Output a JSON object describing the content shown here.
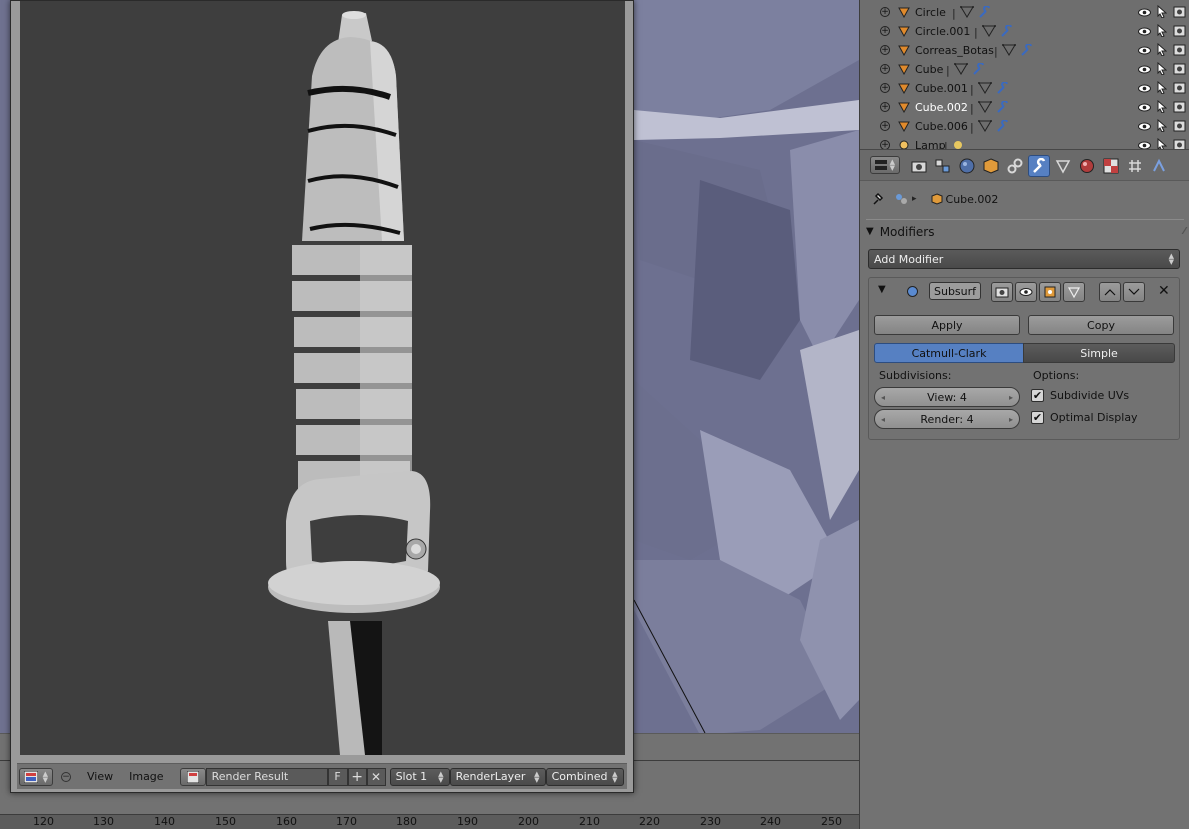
{
  "outliner": {
    "items": [
      {
        "name": "Circle",
        "icon": "mesh-triangle-icon",
        "extras": [
          "mesh-data-icon",
          "wrench-icon"
        ],
        "selected": false
      },
      {
        "name": "Circle.001",
        "icon": "mesh-triangle-icon",
        "extras": [
          "mesh-data-icon",
          "wrench-icon"
        ],
        "selected": false
      },
      {
        "name": "Correas_Botas",
        "icon": "mesh-triangle-icon",
        "extras": [
          "mesh-data-icon",
          "wrench-icon"
        ],
        "selected": false
      },
      {
        "name": "Cube",
        "icon": "mesh-triangle-icon",
        "extras": [
          "mesh-data-icon",
          "wrench-icon"
        ],
        "selected": false
      },
      {
        "name": "Cube.001",
        "icon": "mesh-triangle-icon",
        "extras": [
          "mesh-data-icon",
          "wrench-icon"
        ],
        "selected": false
      },
      {
        "name": "Cube.002",
        "icon": "mesh-triangle-icon",
        "extras": [
          "mesh-data-icon",
          "wrench-icon"
        ],
        "selected": true
      },
      {
        "name": "Cube.006",
        "icon": "mesh-triangle-icon",
        "extras": [
          "mesh-data-icon",
          "wrench-icon"
        ],
        "selected": false
      },
      {
        "name": "Lamp",
        "icon": "lamp-icon",
        "extras": [
          "lamp-data-icon"
        ],
        "selected": false
      }
    ]
  },
  "properties": {
    "breadcrumb": {
      "object": "Cube.002"
    },
    "panel_title": "Modifiers",
    "add_modifier": "Add Modifier",
    "modifier": {
      "name": "Subsurf",
      "apply_label": "Apply",
      "copy_label": "Copy",
      "mode_options": [
        "Catmull-Clark",
        "Simple"
      ],
      "mode_selected": "Catmull-Clark",
      "subdivisions_label": "Subdivisions:",
      "options_label": "Options:",
      "view_field": "View: 4",
      "render_field": "Render: 4",
      "subdivide_uvs_label": "Subdivide UVs",
      "subdivide_uvs_checked": true,
      "optimal_display_label": "Optimal Display",
      "optimal_display_checked": true
    }
  },
  "image_editor": {
    "menu_view": "View",
    "menu_image": "Image",
    "image_name": "Render Result",
    "fake_user": "F",
    "slot": "Slot 1",
    "render_layer": "RenderLayer",
    "pass": "Combined"
  },
  "timeline": {
    "ticks": [
      "120",
      "130",
      "140",
      "150",
      "160",
      "170",
      "180",
      "190",
      "200",
      "210",
      "220",
      "230",
      "240",
      "250"
    ]
  },
  "colors": {
    "accent": "#5680c2",
    "viewport_bg": "#6f7290",
    "panel_bg": "#727272",
    "selected_text": "#ffffff",
    "mesh_icon": "#e08a2c"
  }
}
